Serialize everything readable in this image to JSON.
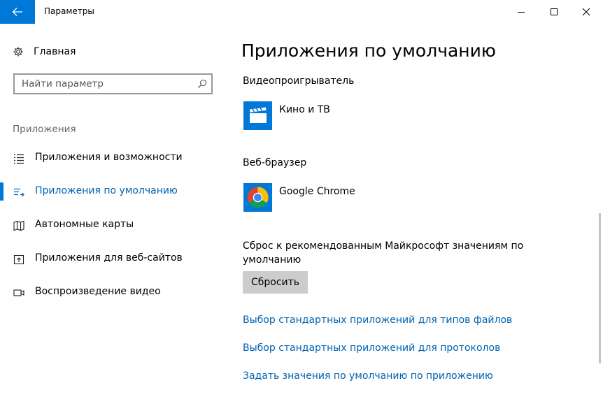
{
  "window": {
    "title": "Параметры"
  },
  "sidebar": {
    "home_label": "Главная",
    "search_placeholder": "Найти параметр",
    "section_label": "Приложения",
    "items": [
      {
        "label": "Приложения и возможности",
        "icon": "apps-list-icon"
      },
      {
        "label": "Приложения по умолчанию",
        "icon": "default-apps-icon",
        "active": true
      },
      {
        "label": "Автономные карты",
        "icon": "map-icon"
      },
      {
        "label": "Приложения для веб-сайтов",
        "icon": "web-app-icon"
      },
      {
        "label": "Воспроизведение видео",
        "icon": "video-icon"
      }
    ]
  },
  "main": {
    "title": "Приложения по умолчанию",
    "video_player": {
      "label": "Видеопроигрыватель",
      "app_name": "Кино и ТВ"
    },
    "web_browser": {
      "label": "Веб-браузер",
      "app_name": "Google Chrome"
    },
    "reset": {
      "text": "Сброс к рекомендованным Майкрософт значениям по умолчанию",
      "button_label": "Сбросить"
    },
    "links": [
      "Выбор стандартных приложений для типов файлов",
      "Выбор стандартных приложений для протоколов",
      "Задать значения по умолчанию по приложению"
    ]
  },
  "colors": {
    "accent": "#0078d7",
    "link": "#0063b1",
    "button_bg": "#cccccc"
  }
}
